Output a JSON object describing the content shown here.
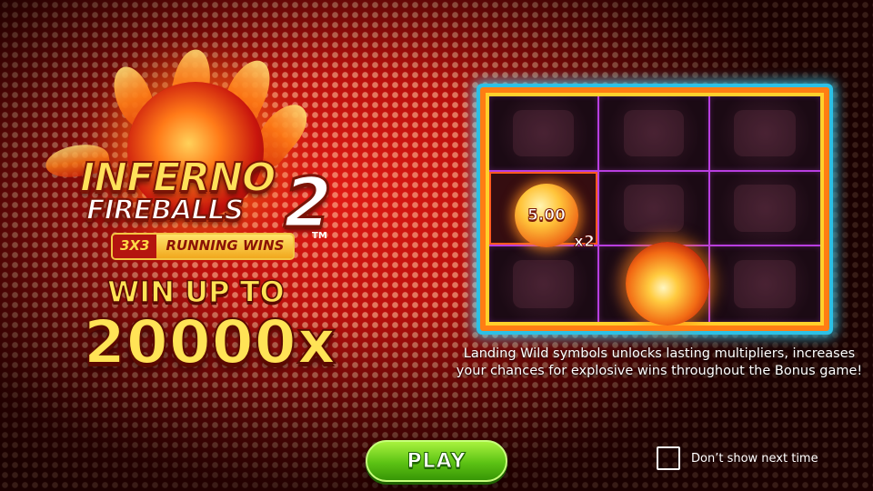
{
  "logo": {
    "title_line1": "INFERNO",
    "title_line2": "FIREBALLS",
    "title_number": "2",
    "badge_left": "3X3",
    "badge_right": "RUNNING WINS",
    "trademark": "TM"
  },
  "win": {
    "label": "WIN UP TO",
    "value": "20000x"
  },
  "grid": {
    "wild_value": "5.00",
    "multiplier": "x2"
  },
  "description": "Landing Wild symbols unlocks lasting multipliers, increases your chances for explosive wins throughout the Bonus game!",
  "play_button": "PLAY",
  "dont_show": {
    "label": "Don’t show next time",
    "checked": false
  },
  "colors": {
    "background": "#c8120d",
    "panel_border": "#2cc1e6",
    "play_button": "#5cc214",
    "title_yellow": "#ffe356"
  }
}
